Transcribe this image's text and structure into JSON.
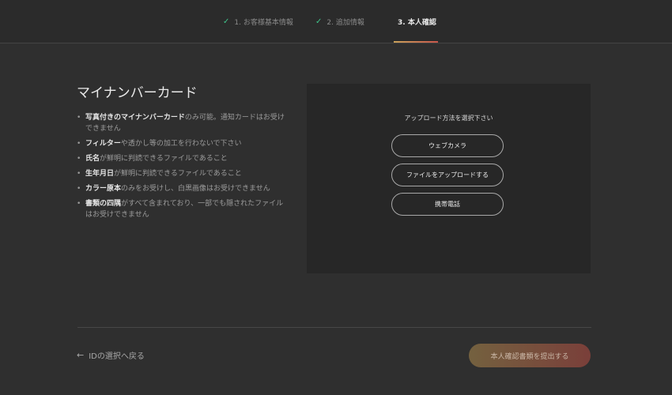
{
  "steps": [
    {
      "label": "1. お客様基本情報",
      "state": "done"
    },
    {
      "label": "2. 追加情報",
      "state": "done"
    },
    {
      "label": "3. 本人確認",
      "state": "active"
    }
  ],
  "card": {
    "title": "マイナンバーカード",
    "rules": [
      {
        "strong": "写真付きのマイナンバーカード",
        "rest": "のみ可能。通知カードはお受けできません"
      },
      {
        "strong": "フィルター",
        "rest": "や透かし等の加工を行わないで下さい"
      },
      {
        "strong": "氏名",
        "rest": "が鮮明に判読できるファイルであること"
      },
      {
        "strong": "生年月日",
        "rest": "が鮮明に判読できるファイルであること"
      },
      {
        "strong": "カラー原本",
        "rest": "のみをお受けし、白黒画像はお受けできません"
      },
      {
        "strong": "書類の四隅",
        "rest": "がすべて含まれており、一部でも隠されたファイルはお受けできません"
      }
    ]
  },
  "upload": {
    "caption": "アップロード方法を選択下さい",
    "webcam_label": "ウェブカメラ",
    "file_label": "ファイルをアップロードする",
    "mobile_label": "携帯電話"
  },
  "footer": {
    "back_label": "IDの選択へ戻る",
    "submit_label": "本人確認書類を提出する"
  },
  "colors": {
    "check": "#3fc48a",
    "accent_start": "#c9a25a",
    "accent_end": "#c8564b"
  },
  "icons": {
    "step_done": "checkmark-icon",
    "back": "left-arrow-icon"
  }
}
